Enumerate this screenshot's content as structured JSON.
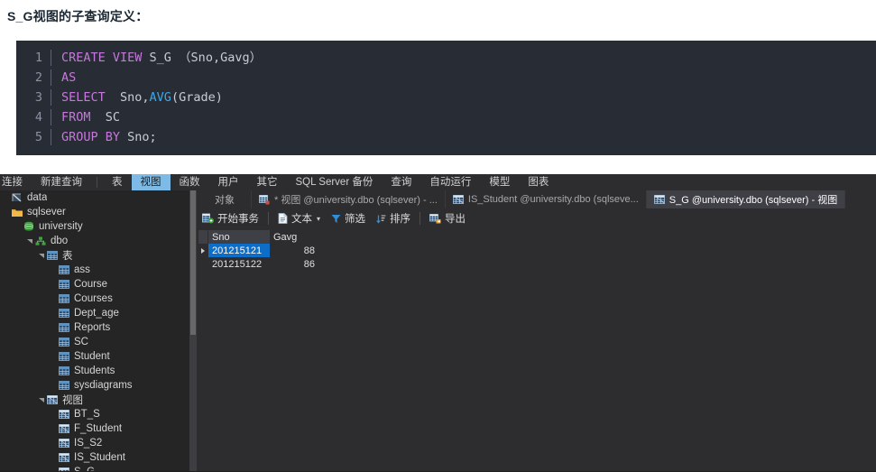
{
  "doc": {
    "title": "S_G视图的子查询定义："
  },
  "code": {
    "lines": [
      {
        "no": "1",
        "tokens": [
          {
            "t": "CREATE VIEW ",
            "c": "kw"
          },
          {
            "t": "S_G （Sno,Gavg）",
            "c": "id"
          }
        ]
      },
      {
        "no": "2",
        "tokens": [
          {
            "t": "AS",
            "c": "kw"
          }
        ]
      },
      {
        "no": "3",
        "tokens": [
          {
            "t": "SELECT ",
            "c": "kw"
          },
          {
            "t": " Sno,",
            "c": "id"
          },
          {
            "t": "AVG",
            "c": "fn"
          },
          {
            "t": "(Grade)",
            "c": "id"
          }
        ]
      },
      {
        "no": "4",
        "tokens": [
          {
            "t": "FROM ",
            "c": "kw"
          },
          {
            "t": " SC",
            "c": "id"
          }
        ]
      },
      {
        "no": "5",
        "tokens": [
          {
            "t": "GROUP BY ",
            "c": "kw"
          },
          {
            "t": "Sno;",
            "c": "id"
          }
        ]
      }
    ]
  },
  "app": {
    "menubar": [
      {
        "label": "连接",
        "active": false
      },
      {
        "label": "新建查询",
        "active": false
      },
      {
        "sep": true
      },
      {
        "label": "表",
        "active": false
      },
      {
        "label": "视图",
        "active": true
      },
      {
        "label": "函数",
        "active": false
      },
      {
        "label": "用户",
        "active": false
      },
      {
        "label": "其它",
        "active": false
      },
      {
        "label": "SQL Server 备份",
        "active": false
      },
      {
        "label": "查询",
        "active": false
      },
      {
        "label": "自动运行",
        "active": false
      },
      {
        "label": "模型",
        "active": false
      },
      {
        "label": "图表",
        "active": false
      }
    ],
    "sidebar": {
      "items": [
        {
          "label": "data",
          "indent": 0,
          "icon": "server-icon",
          "twisty": "none"
        },
        {
          "label": "sqlsever",
          "indent": 0,
          "icon": "folder-icon",
          "twisty": "none"
        },
        {
          "label": "university",
          "indent": 1,
          "icon": "database-icon",
          "twisty": "none"
        },
        {
          "label": "dbo",
          "indent": 2,
          "icon": "schema-icon",
          "twisty": "open"
        },
        {
          "label": "表",
          "indent": 3,
          "icon": "table-icon",
          "twisty": "open"
        },
        {
          "label": "ass",
          "indent": 4,
          "icon": "table-icon",
          "twisty": "none"
        },
        {
          "label": "Course",
          "indent": 4,
          "icon": "table-icon",
          "twisty": "none"
        },
        {
          "label": "Courses",
          "indent": 4,
          "icon": "table-icon",
          "twisty": "none"
        },
        {
          "label": "Dept_age",
          "indent": 4,
          "icon": "table-icon",
          "twisty": "none"
        },
        {
          "label": "Reports",
          "indent": 4,
          "icon": "table-icon",
          "twisty": "none"
        },
        {
          "label": "SC",
          "indent": 4,
          "icon": "table-icon",
          "twisty": "none"
        },
        {
          "label": "Student",
          "indent": 4,
          "icon": "table-icon",
          "twisty": "none"
        },
        {
          "label": "Students",
          "indent": 4,
          "icon": "table-icon",
          "twisty": "none"
        },
        {
          "label": "sysdiagrams",
          "indent": 4,
          "icon": "table-icon",
          "twisty": "none"
        },
        {
          "label": "视图",
          "indent": 3,
          "icon": "view-icon",
          "twisty": "open"
        },
        {
          "label": "BT_S",
          "indent": 4,
          "icon": "view-icon",
          "twisty": "none"
        },
        {
          "label": "F_Student",
          "indent": 4,
          "icon": "view-icon",
          "twisty": "none"
        },
        {
          "label": "IS_S2",
          "indent": 4,
          "icon": "view-icon",
          "twisty": "none"
        },
        {
          "label": "IS_Student",
          "indent": 4,
          "icon": "view-icon",
          "twisty": "none"
        },
        {
          "label": "S_G",
          "indent": 4,
          "icon": "view-icon",
          "twisty": "none"
        }
      ]
    },
    "tabs": [
      {
        "label": "对象",
        "icon": "none",
        "active": false,
        "kind": "object"
      },
      {
        "label": "* 视图 @university.dbo (sqlsever) - ...",
        "icon": "designer-icon",
        "active": false,
        "kind": "doc"
      },
      {
        "label": "IS_Student @university.dbo (sqlseve...",
        "icon": "view-icon",
        "active": false,
        "kind": "doc"
      },
      {
        "label": "S_G @university.dbo (sqlsever) - 视图",
        "icon": "view-icon",
        "active": true,
        "kind": "doc"
      }
    ],
    "toolbar": [
      {
        "label": "开始事务",
        "icon": "transaction-icon",
        "caret": false
      },
      {
        "sep": true
      },
      {
        "label": "文本",
        "icon": "text-icon",
        "caret": true
      },
      {
        "label": "筛选",
        "icon": "filter-icon",
        "caret": false
      },
      {
        "label": "排序",
        "icon": "sort-icon",
        "caret": false
      },
      {
        "sep": true
      },
      {
        "label": "导出",
        "icon": "export-icon",
        "caret": false
      }
    ],
    "grid": {
      "columns": [
        "Sno",
        "Gavg"
      ],
      "rows": [
        {
          "cells": [
            "201215121",
            "88"
          ],
          "selected": true
        },
        {
          "cells": [
            "201215122",
            "86"
          ],
          "selected": false
        }
      ]
    }
  },
  "colors": {
    "accent_selection": "#0e6dc7",
    "menu_active": "#7dbbe6",
    "code_bg": "#282c34",
    "keyword": "#c678dd",
    "function": "#3ea8e8"
  }
}
